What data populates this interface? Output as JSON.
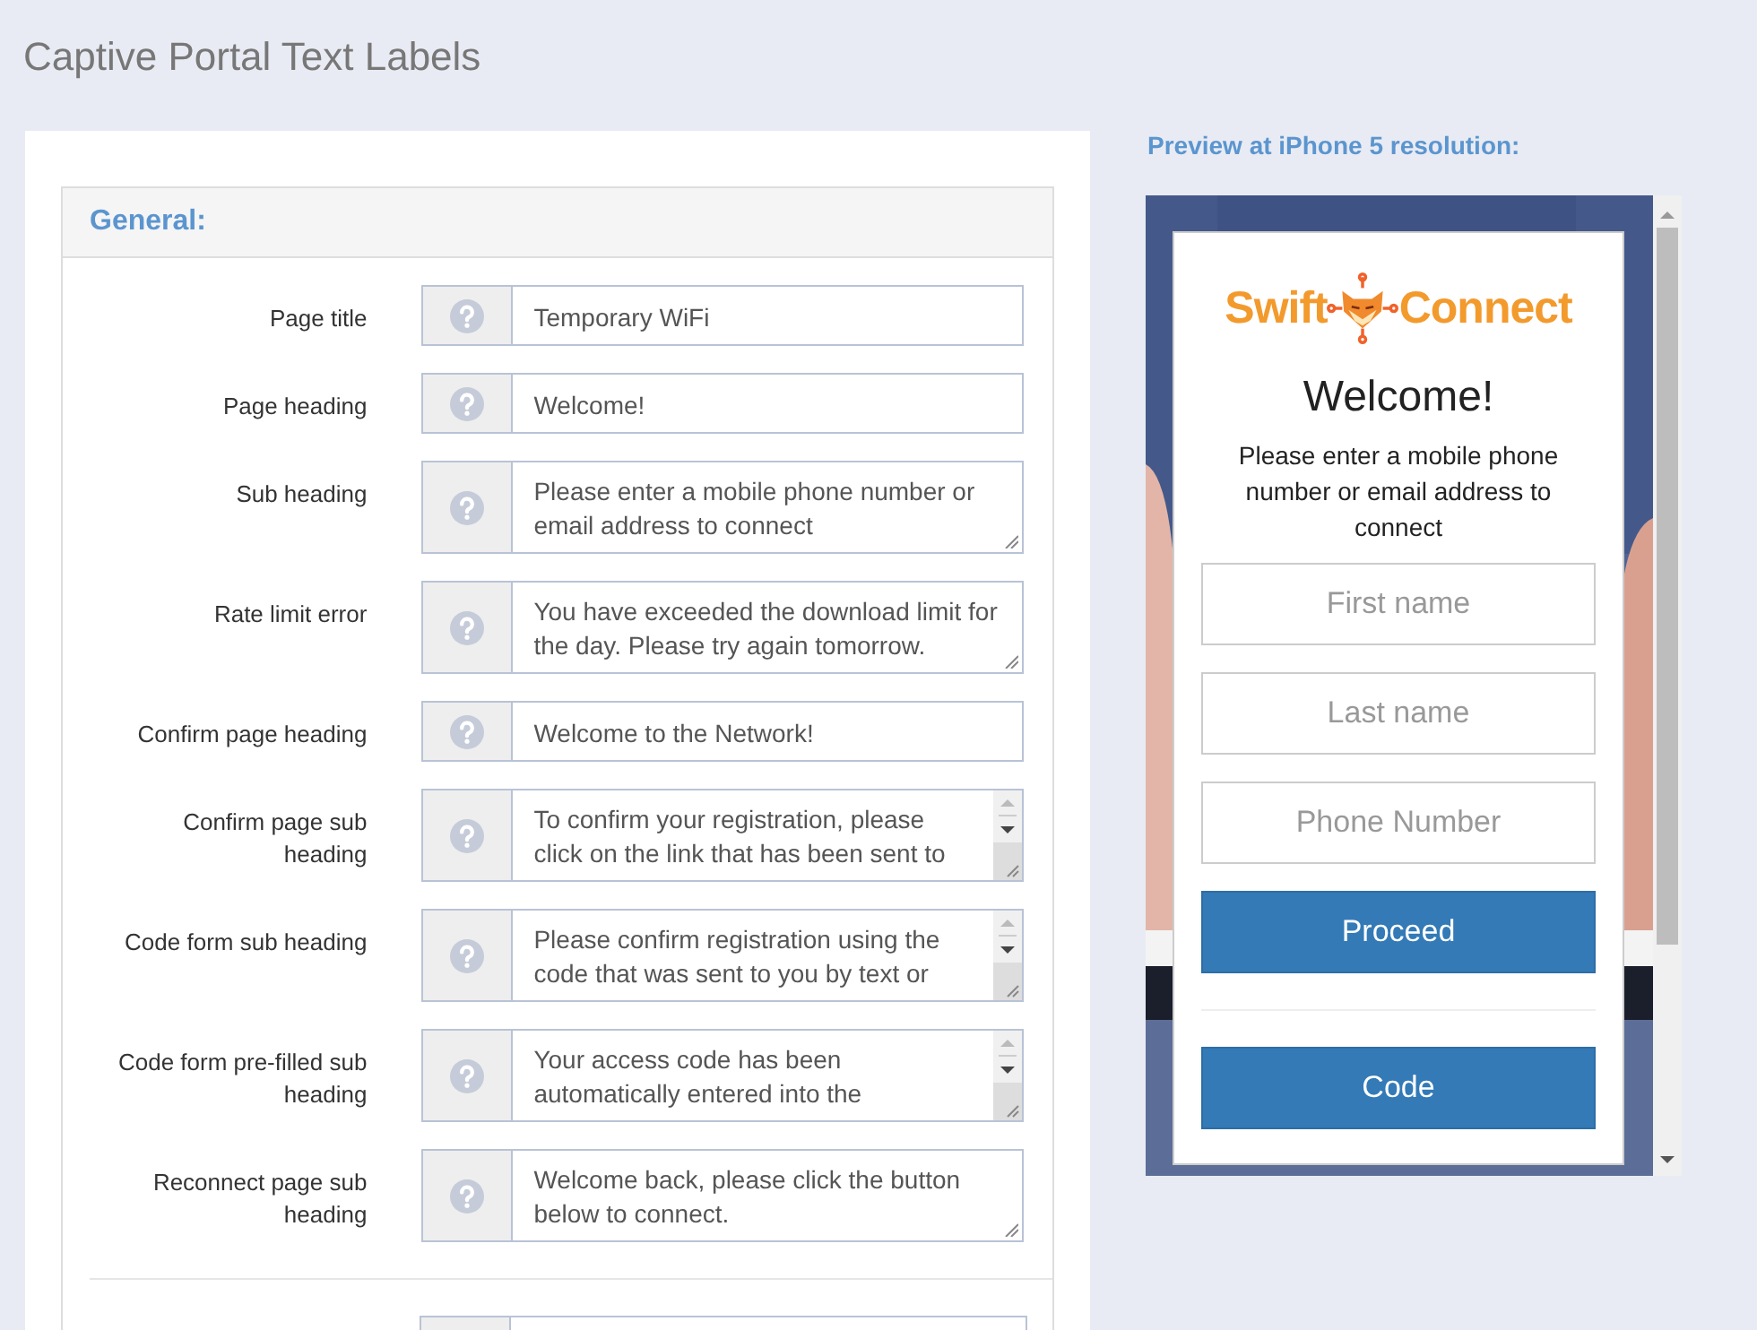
{
  "page_title": "Captive Portal Text Labels",
  "section": {
    "title": "General:",
    "fields": [
      {
        "label": "Page title",
        "value": "Temporary WiFi",
        "kind": "line"
      },
      {
        "label": "Page heading",
        "value": "Welcome!",
        "kind": "line"
      },
      {
        "label": "Sub heading",
        "value": "Please enter a mobile phone number or email address to connect",
        "kind": "area"
      },
      {
        "label": "Rate limit error",
        "value": "You have exceeded the download limit for the day. Please try again tomorrow.",
        "kind": "area"
      },
      {
        "label": "Confirm page heading",
        "value": "Welcome to the Network!",
        "kind": "line"
      },
      {
        "label": "Confirm page sub heading",
        "value": "To confirm your registration, please click on the link that has been sent to",
        "kind": "scroll"
      },
      {
        "label": "Code form sub heading",
        "value": "Please confirm registration using the code that was sent to you by text or",
        "kind": "scroll"
      },
      {
        "label": "Code form pre-filled sub heading",
        "value": "Your access code has been automatically entered into the",
        "kind": "scroll"
      },
      {
        "label": "Reconnect page sub heading",
        "value": "Welcome back, please click the button below to connect.",
        "kind": "area"
      }
    ]
  },
  "preview": {
    "caption": "Preview at iPhone 5 resolution:",
    "logo": {
      "left": "Swift",
      "right": "Connect"
    },
    "heading": "Welcome!",
    "subheading": "Please enter a mobile phone number or email address to connect",
    "inputs": [
      {
        "placeholder": "First name"
      },
      {
        "placeholder": "Last name"
      },
      {
        "placeholder": "Phone Number"
      }
    ],
    "buttons": [
      "Proceed",
      "Code"
    ]
  }
}
